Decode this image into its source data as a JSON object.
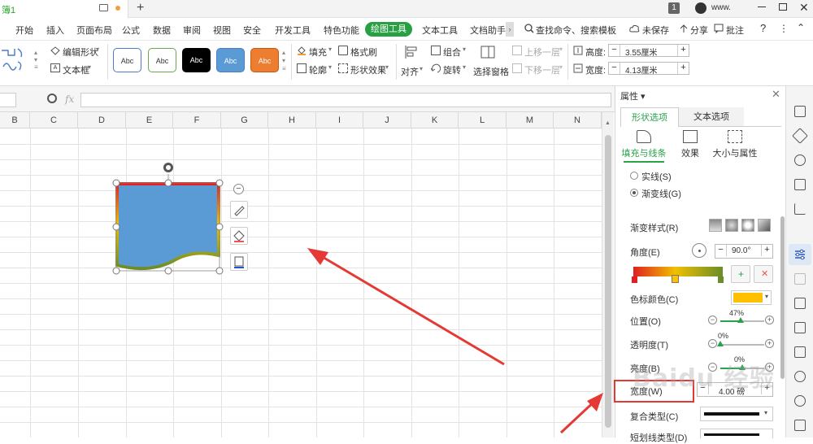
{
  "titlebar": {
    "doc_tab": "簿1",
    "new_tab": "+",
    "page_badge": "1",
    "user_name": "www."
  },
  "menu": {
    "items": [
      "开始",
      "插入",
      "页面布局",
      "公式",
      "数据",
      "审阅",
      "视图",
      "安全",
      "开发工具",
      "特色功能",
      "绘图工具",
      "文本工具",
      "文档助手"
    ],
    "more": "›",
    "search": "查找命令、搜索模板",
    "unsaved": "未保存",
    "share": "分享",
    "comment": "批注",
    "help": "?"
  },
  "toolbar": {
    "edit_shape": "编辑形状",
    "text_box": "文本框",
    "swatches": [
      "Abc",
      "Abc",
      "Abc",
      "Abc",
      "Abc"
    ],
    "fill": "填充",
    "format_brush": "格式刷",
    "outline": "轮廓",
    "shape_effect": "形状效果",
    "group": "组合",
    "rotate": "旋转",
    "align": "对齐",
    "select_pane": "选择窗格",
    "bring_forward": "上移一层",
    "send_backward": "下移一层",
    "height_label": "高度:",
    "height_value": "3.55厘米",
    "width_label": "宽度:",
    "width_value": "4.13厘米"
  },
  "formula": {
    "fx": "fx"
  },
  "grid": {
    "columns": [
      "B",
      "C",
      "D",
      "E",
      "F",
      "G",
      "H",
      "I",
      "J",
      "K",
      "L",
      "M",
      "N"
    ]
  },
  "panel": {
    "title": "属性",
    "tab_shape": "形状选项",
    "tab_text": "文本选项",
    "sub_fill_line": "填充与线条",
    "sub_effect": "效果",
    "sub_size": "大小与属性",
    "solid_line": "实线(S)",
    "gradient_line": "渐变线(G)",
    "gradient_style": "渐变样式(R)",
    "angle": "角度(E)",
    "angle_value": "90.0°",
    "stop_color": "色标颜色(C)",
    "position": "位置(O)",
    "position_value": "47%",
    "transparency": "透明度(T)",
    "transparency_value": "0%",
    "brightness": "亮度(B)",
    "brightness_value": "0%",
    "width": "宽度(W)",
    "width_value": "4.00 磅",
    "compound_type": "复合类型(C)",
    "dash_type": "短划线类型(D)",
    "stop_color_hex": "#ffc000"
  },
  "watermark": "Baidu 经验"
}
